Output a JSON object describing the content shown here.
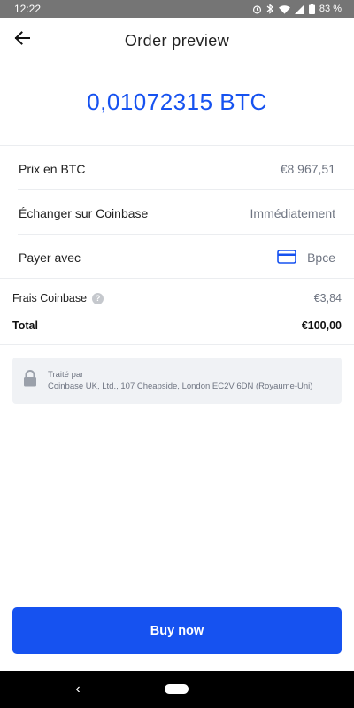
{
  "status_bar": {
    "time": "12:22",
    "battery": "83 %",
    "icons": [
      "alarm-icon",
      "bluetooth-icon",
      "wifi-icon",
      "signal-icon",
      "battery-icon"
    ]
  },
  "header": {
    "title": "Order preview",
    "back_icon": "arrow-left-icon"
  },
  "amount": "0,01072315 BTC",
  "rows": [
    {
      "label": "Prix en BTC",
      "value": "€8 967,51"
    },
    {
      "label": "Échanger sur Coinbase",
      "value": "Immédiatement"
    },
    {
      "label": "Payer avec",
      "value": "Bpce",
      "icon": "credit-card-icon"
    }
  ],
  "fees": {
    "label": "Frais Coinbase",
    "value": "€3,84",
    "help_icon": "?"
  },
  "total": {
    "label": "Total",
    "value": "€100,00"
  },
  "info": {
    "title": "Traité par",
    "text": "Coinbase UK, Ltd., 107 Cheapside, London EC2V 6DN (Royaume-Uni)",
    "icon": "lock-icon"
  },
  "buy_button": "Buy now",
  "colors": {
    "accent": "#1652f0",
    "status_bar": "#757575",
    "nav_bar": "#000000",
    "muted_text": "#6e7481",
    "info_bg": "#f0f2f5"
  },
  "nav_bar": {
    "back_glyph": "‹"
  }
}
